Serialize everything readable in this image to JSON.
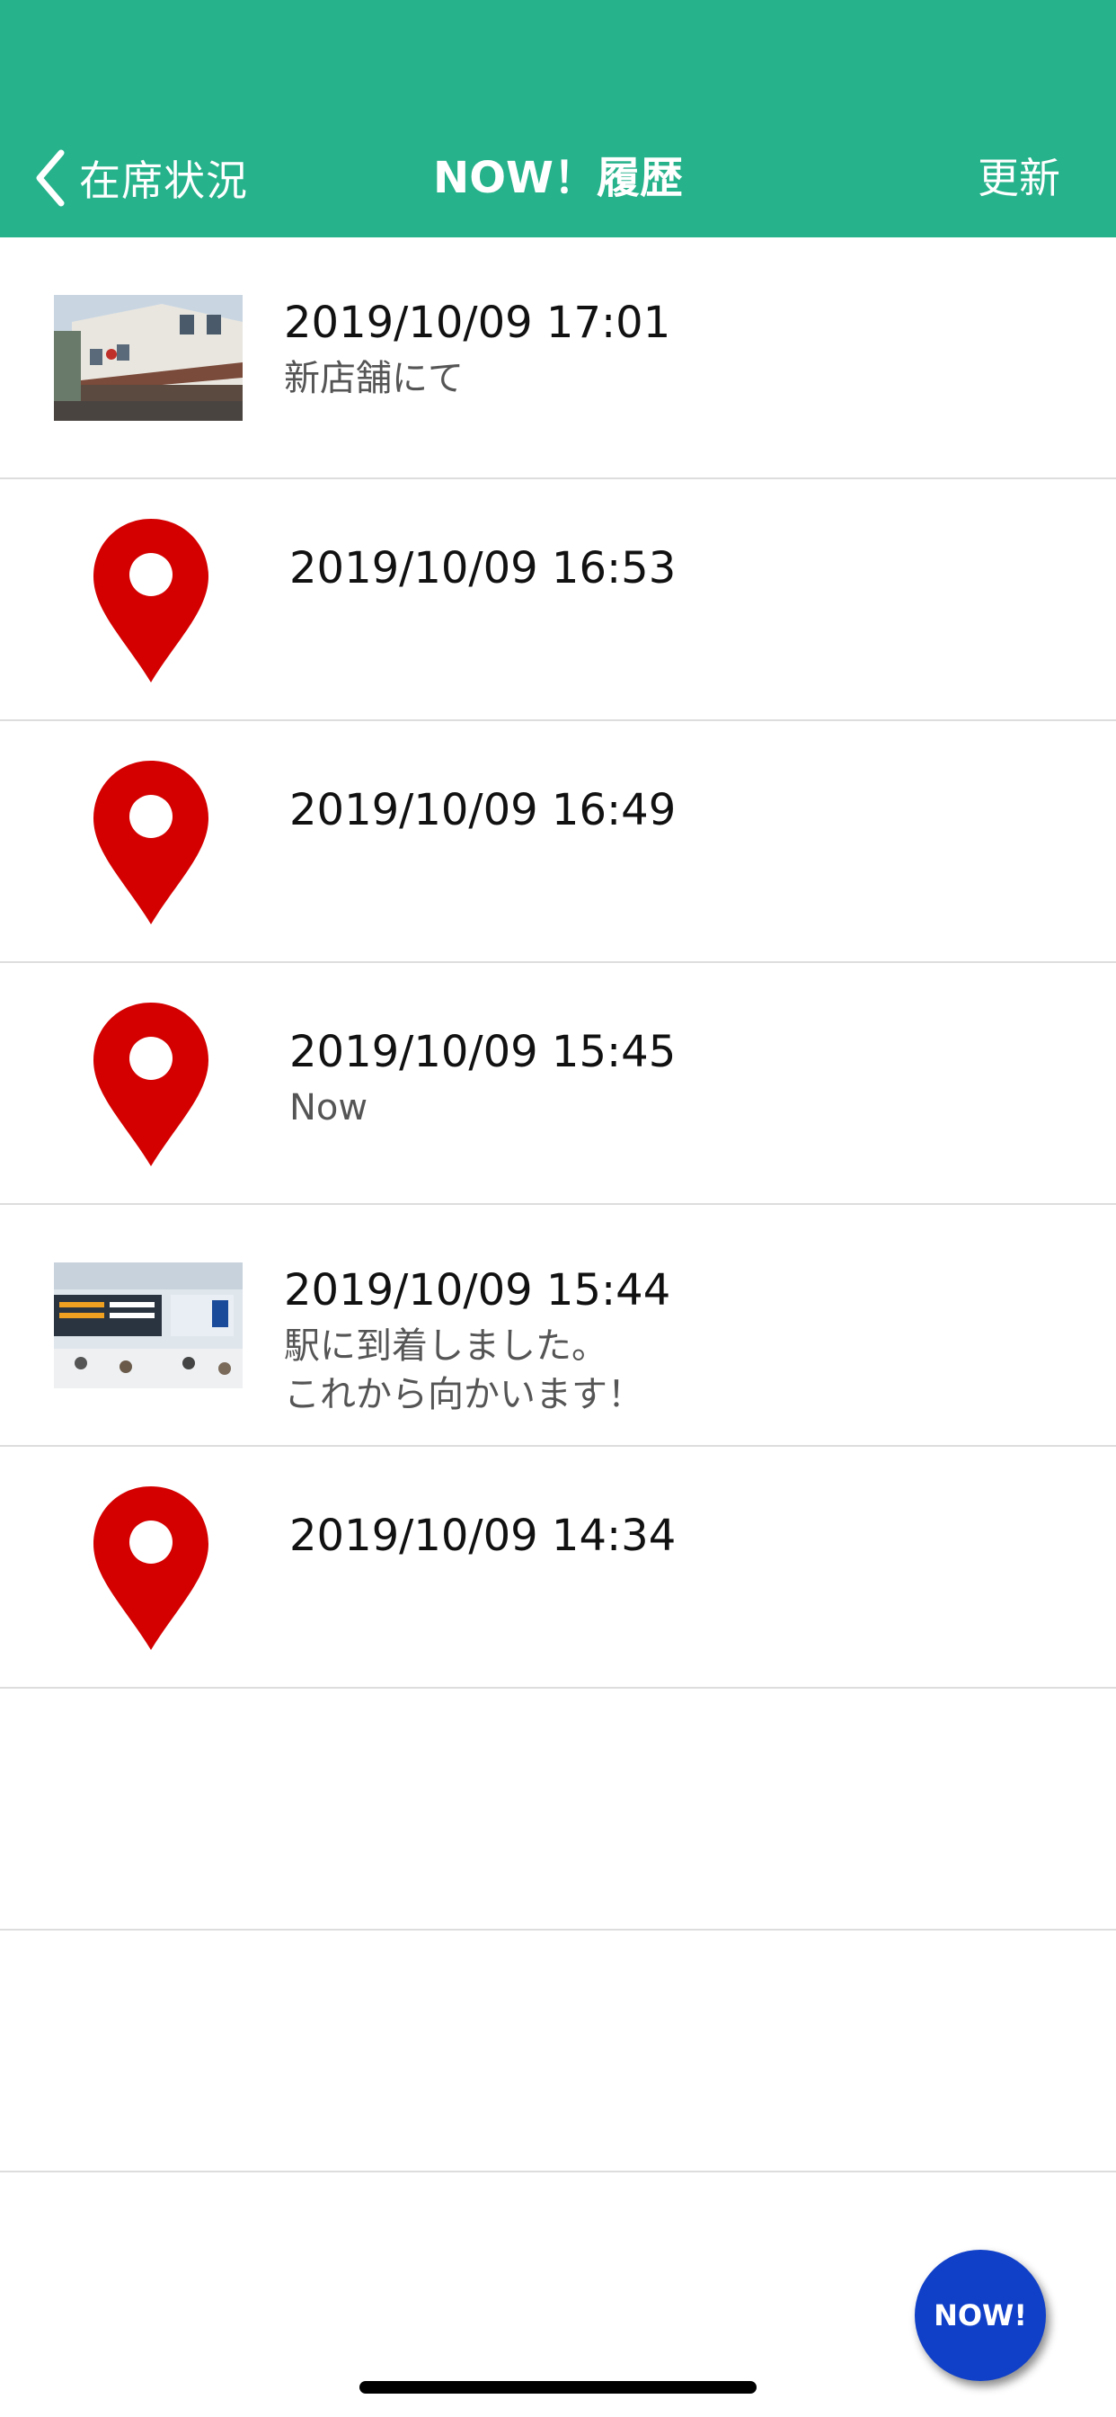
{
  "header": {
    "back_label": "在席状況",
    "title": "NOW！履歴",
    "refresh_label": "更新",
    "background_color": "#26b28b"
  },
  "history": [
    {
      "kind": "photo",
      "photo_scene": "storefront-icon",
      "time": "2019/10/09 17:01",
      "note": "新店舗にて"
    },
    {
      "kind": "location",
      "time": "2019/10/09 16:53",
      "note": ""
    },
    {
      "kind": "location",
      "time": "2019/10/09 16:49",
      "note": ""
    },
    {
      "kind": "location",
      "time": "2019/10/09 15:45",
      "note": "Now"
    },
    {
      "kind": "photo",
      "photo_scene": "station-icon",
      "time": "2019/10/09 15:44",
      "note": "駅に到着しました。\nこれから向かいます！"
    },
    {
      "kind": "location",
      "time": "2019/10/09 14:34",
      "note": ""
    }
  ],
  "pin_color": "#d40000",
  "fab": {
    "label": "NOW!",
    "color": "#1040c8"
  }
}
